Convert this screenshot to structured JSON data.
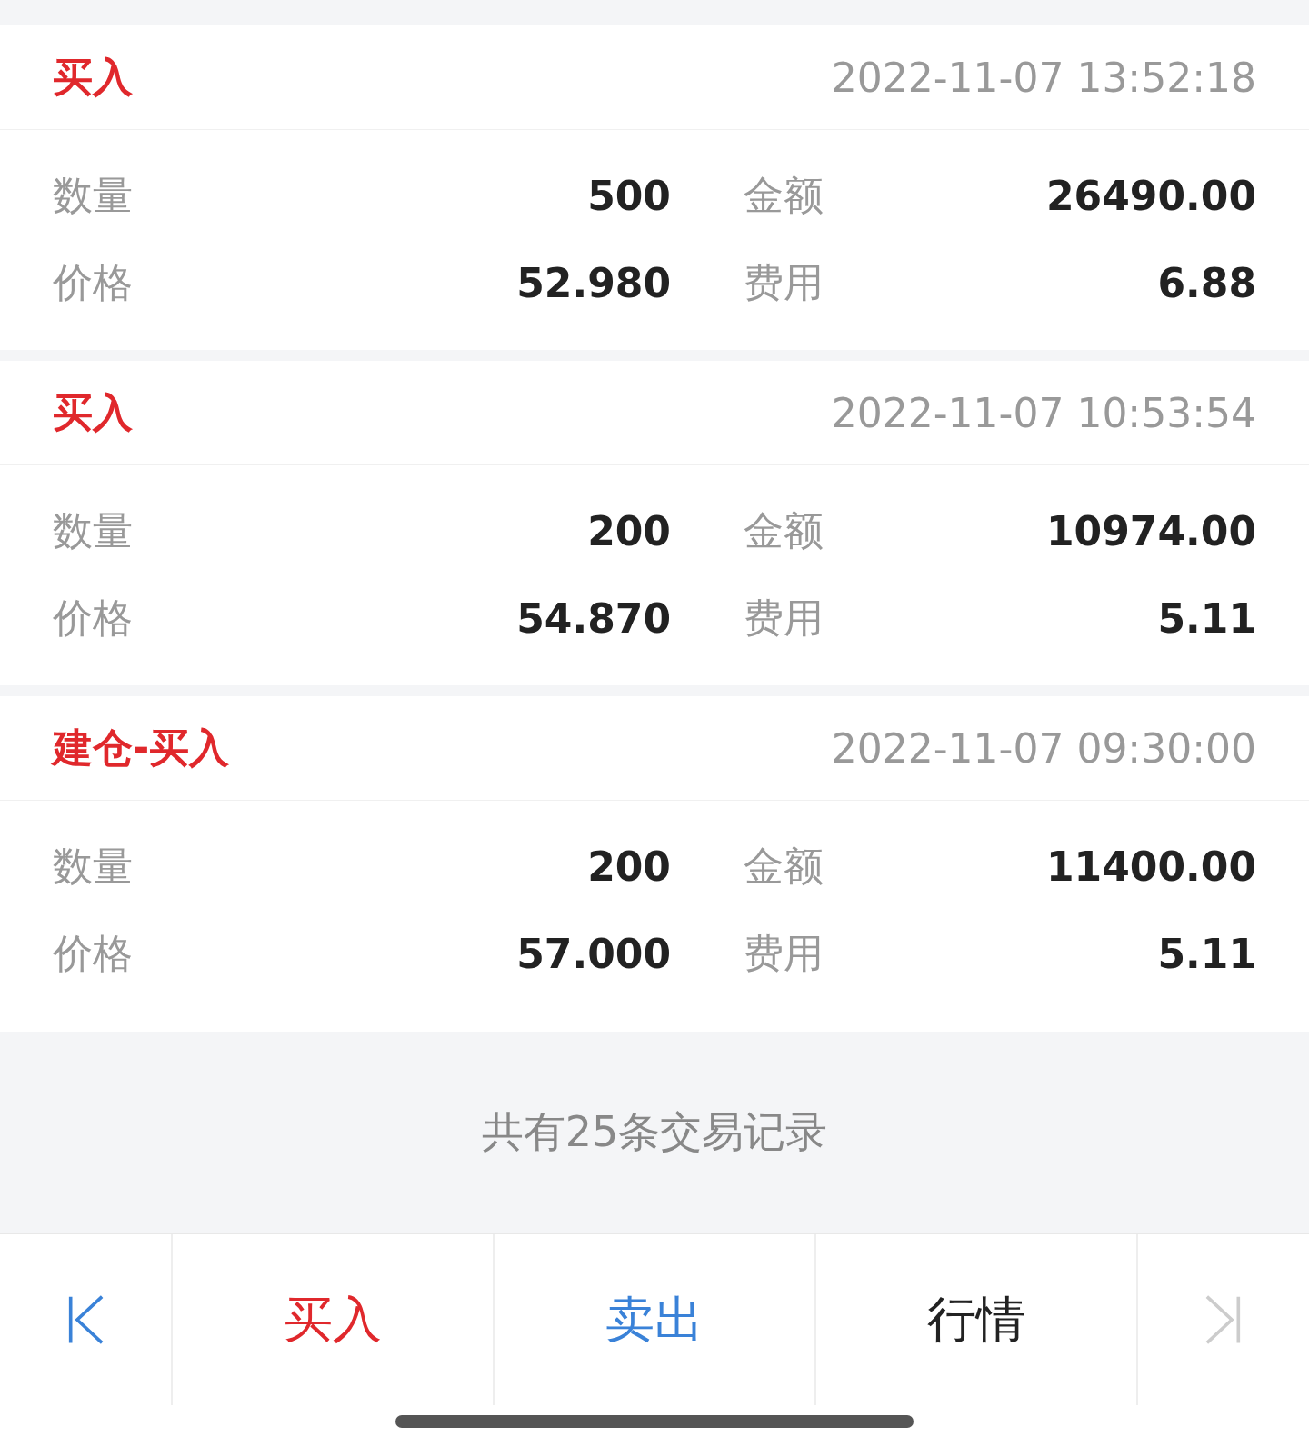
{
  "records": [
    {
      "type": "买入",
      "time": "2022-11-07 13:52:18",
      "fields": [
        {
          "label": "数量",
          "value": "500"
        },
        {
          "label": "金额",
          "value": "26490.00"
        },
        {
          "label": "价格",
          "value": "52.980"
        },
        {
          "label": "费用",
          "value": "6.88"
        }
      ]
    },
    {
      "type": "买入",
      "time": "2022-11-07 10:53:54",
      "fields": [
        {
          "label": "数量",
          "value": "200"
        },
        {
          "label": "金额",
          "value": "10974.00"
        },
        {
          "label": "价格",
          "value": "54.870"
        },
        {
          "label": "费用",
          "value": "5.11"
        }
      ]
    },
    {
      "type": "建仓-买入",
      "time": "2022-11-07 09:30:00",
      "fields": [
        {
          "label": "数量",
          "value": "200"
        },
        {
          "label": "金额",
          "value": "11400.00"
        },
        {
          "label": "价格",
          "value": "57.000"
        },
        {
          "label": "费用",
          "value": "5.11"
        }
      ]
    }
  ],
  "summary": "共有25条交易记录",
  "nav": [
    {
      "kind": "first",
      "disabled": false
    },
    {
      "kind": "button",
      "label": "买入",
      "color": "#e0282c"
    },
    {
      "kind": "button",
      "label": "卖出",
      "color": "#3a82d8"
    },
    {
      "kind": "button",
      "label": "行情",
      "color": "#222222"
    },
    {
      "kind": "last",
      "disabled": true
    }
  ]
}
